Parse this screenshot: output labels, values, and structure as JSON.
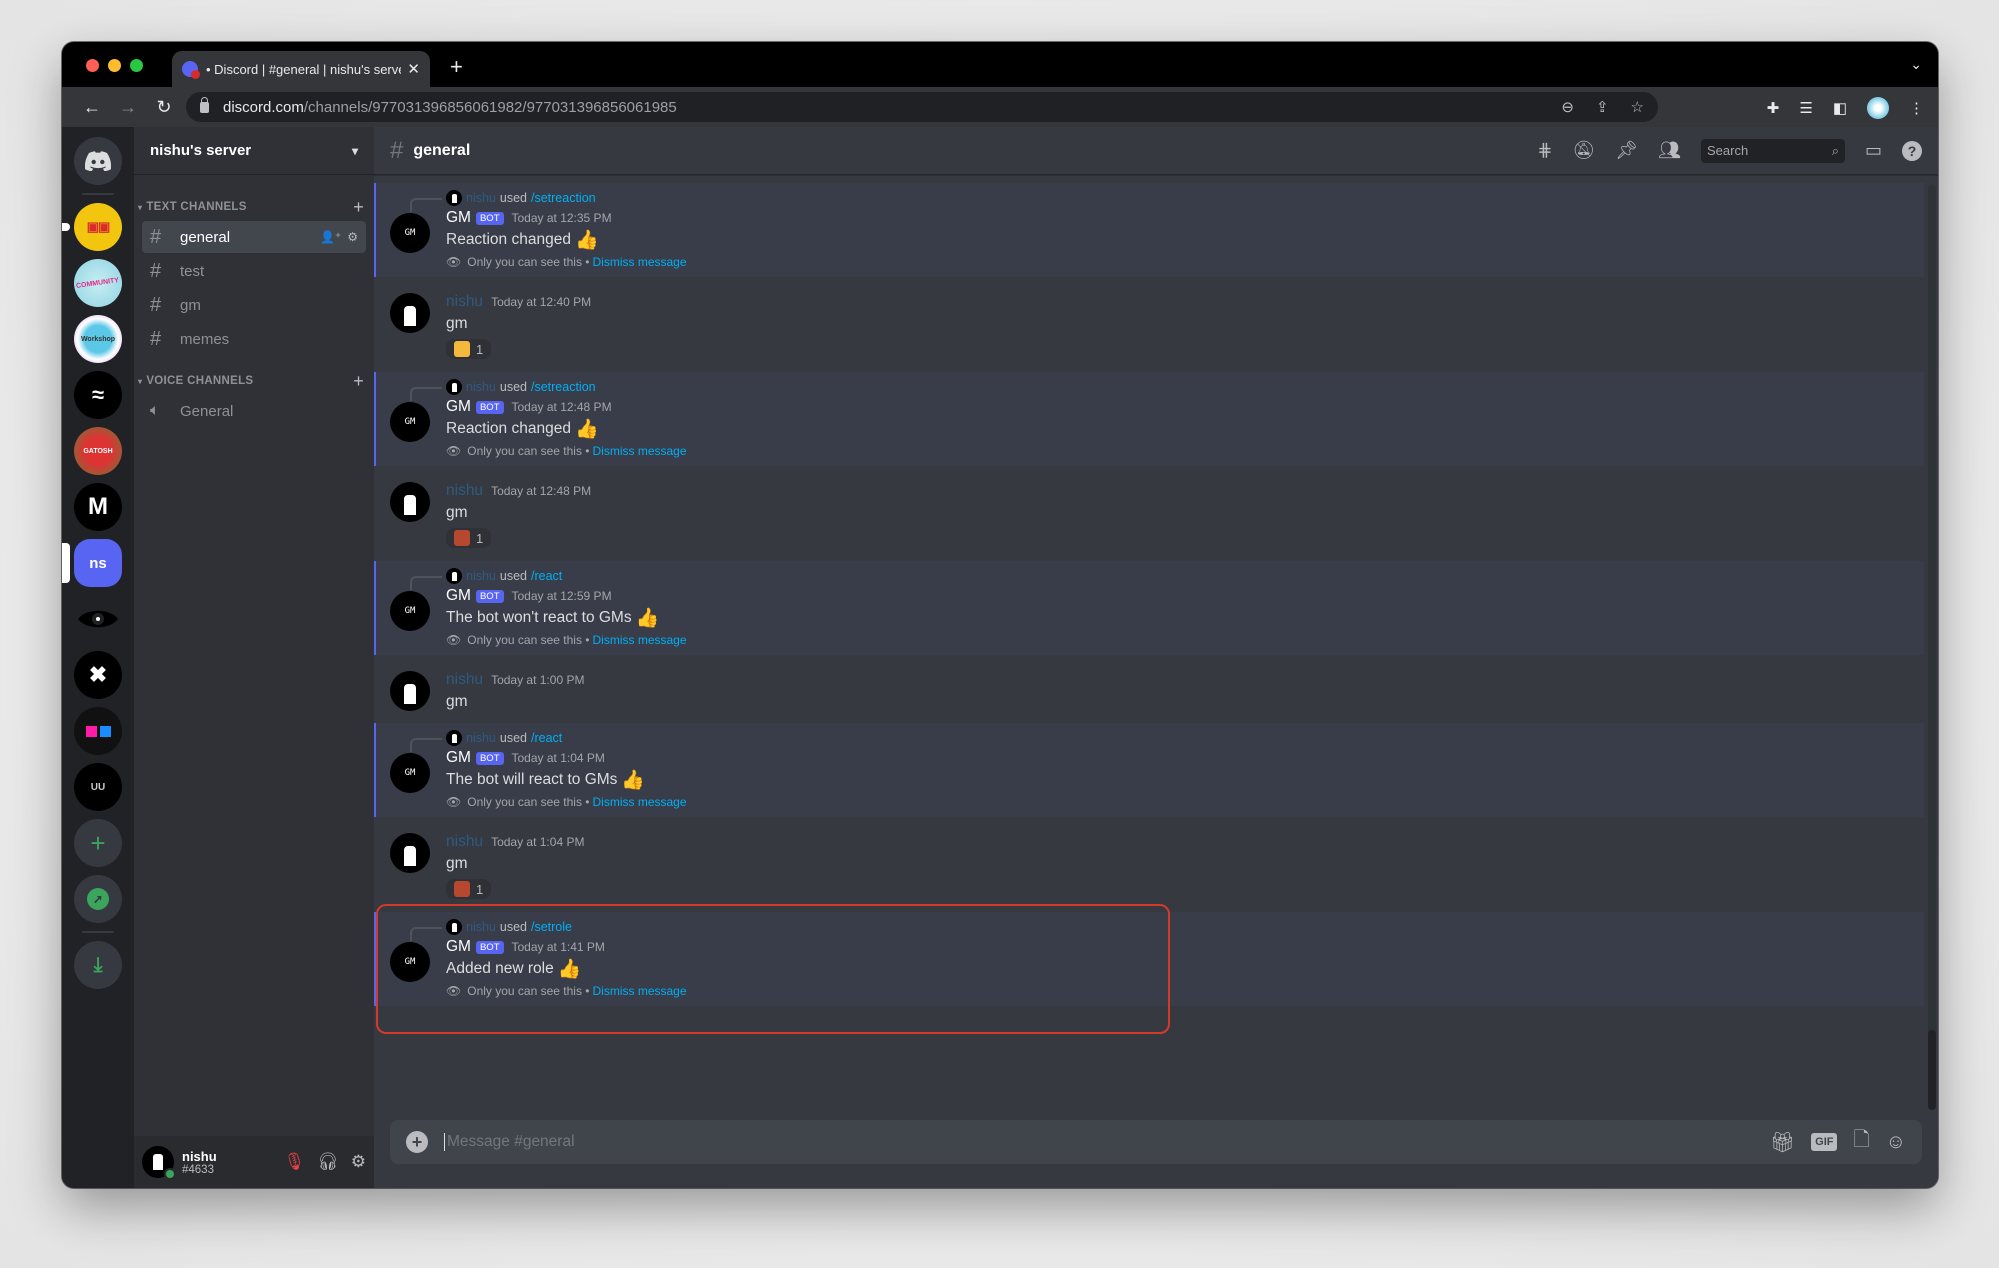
{
  "browser": {
    "tab_title": "• Discord | #general | nishu's server",
    "url_host": "discord.com",
    "url_path": "/channels/977031396856061982/977031396856061985"
  },
  "servers": {
    "home_icon": "discord-logo-icon",
    "items": [
      {
        "name": "server-yellow-glasses",
        "label": "",
        "color": "#f2c50f"
      },
      {
        "name": "server-community-management",
        "label": "",
        "color": "#a8dde8"
      },
      {
        "name": "server-workshop",
        "label": "",
        "color": "#5cc8e8"
      },
      {
        "name": "server-wave",
        "label": "",
        "color": "#000000"
      },
      {
        "name": "server-red-badge",
        "label": "",
        "color": "#c0392b"
      },
      {
        "name": "server-m",
        "label": "M",
        "color": "#000000"
      },
      {
        "name": "server-ns",
        "label": "ns",
        "color": "#5865f2"
      },
      {
        "name": "server-eye",
        "label": "",
        "color": "#000000"
      },
      {
        "name": "server-x",
        "label": "✖",
        "color": "#000000"
      },
      {
        "name": "server-squares",
        "label": "",
        "color": "#111111"
      },
      {
        "name": "server-uu",
        "label": "UU",
        "color": "#000000"
      }
    ],
    "add_server_label": "+",
    "explore_label": "explore",
    "download_label": "download"
  },
  "channels": {
    "server_name": "nishu's server",
    "text_category": "TEXT CHANNELS",
    "voice_category": "VOICE CHANNELS",
    "text_channels": [
      "general",
      "test",
      "gm",
      "memes"
    ],
    "voice_channels": [
      "General"
    ],
    "active": "general"
  },
  "user": {
    "name": "nishu",
    "tag": "#4633",
    "status_color": "#3ba55d"
  },
  "chat": {
    "channel": "general",
    "search_placeholder": "Search",
    "composer_placeholder": "Message #general",
    "messages": [
      {
        "type": "ephemeral",
        "invoker": "nishu",
        "used": "used",
        "command": "/setreaction",
        "author": "GM",
        "badge": "BOT",
        "time": "Today at 12:35 PM",
        "text": "Reaction changed",
        "emoji": "👍",
        "note": "Only you can see this •",
        "dismiss": "Dismiss message"
      },
      {
        "type": "user",
        "author": "nishu",
        "time": "Today at 12:40 PM",
        "text": "gm",
        "reaction": {
          "emoji_color": "#f5b83d",
          "count": "1"
        }
      },
      {
        "type": "ephemeral",
        "invoker": "nishu",
        "used": "used",
        "command": "/setreaction",
        "author": "GM",
        "badge": "BOT",
        "time": "Today at 12:48 PM",
        "text": "Reaction changed",
        "emoji": "👍",
        "note": "Only you can see this •",
        "dismiss": "Dismiss message"
      },
      {
        "type": "user",
        "author": "nishu",
        "time": "Today at 12:48 PM",
        "text": "gm",
        "reaction": {
          "emoji_color": "#b5482e",
          "count": "1"
        }
      },
      {
        "type": "ephemeral",
        "invoker": "nishu",
        "used": "used",
        "command": "/react",
        "author": "GM",
        "badge": "BOT",
        "time": "Today at 12:59 PM",
        "text": "The bot won't react to GMs",
        "emoji": "👍",
        "note": "Only you can see this •",
        "dismiss": "Dismiss message"
      },
      {
        "type": "user",
        "author": "nishu",
        "time": "Today at 1:00 PM",
        "text": "gm"
      },
      {
        "type": "ephemeral",
        "invoker": "nishu",
        "used": "used",
        "command": "/react",
        "author": "GM",
        "badge": "BOT",
        "time": "Today at 1:04 PM",
        "text": "The bot will react to GMs",
        "emoji": "👍",
        "note": "Only you can see this •",
        "dismiss": "Dismiss message"
      },
      {
        "type": "user",
        "author": "nishu",
        "time": "Today at 1:04 PM",
        "text": "gm",
        "reaction": {
          "emoji_color": "#b5482e",
          "count": "1"
        }
      },
      {
        "type": "ephemeral",
        "invoker": "nishu",
        "used": "used",
        "command": "/setrole",
        "author": "GM",
        "badge": "BOT",
        "time": "Today at 1:41 PM",
        "text": "Added new role",
        "emoji": "👍",
        "note": "Only you can see this •",
        "dismiss": "Dismiss message",
        "highlighted": true
      }
    ]
  }
}
